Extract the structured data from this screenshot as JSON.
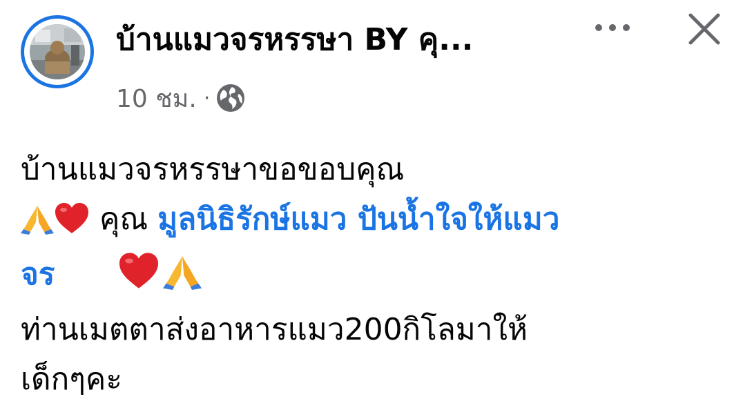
{
  "post": {
    "page_name": "บ้านแมวจรหรรษา BY คุ...",
    "time": "10 ชม.",
    "separator": "·",
    "privacy_icon": "globe-icon",
    "more_icon": "more-dots-icon",
    "close_icon": "close-icon",
    "avatar_icon": "page-avatar",
    "text": {
      "line1": "บ้านแมวจรหรรษาขอขอบคุณ",
      "thanks_prefix": "คุณ",
      "mention_part1": "มูลนิธิรักษ์แมว ปันน้ำใจให้แมว",
      "mention_part2": "จร",
      "line4": " ท่านเมตตาส่งอาหารแมว200กิโลมาให้",
      "line5": "เด็กๆคะ"
    },
    "emojis": [
      "folded-hands-emoji",
      "red-heart-emoji"
    ]
  },
  "colors": {
    "accent": "#1b74e4",
    "secondary_text": "#65676b",
    "primary_text": "#050505"
  }
}
